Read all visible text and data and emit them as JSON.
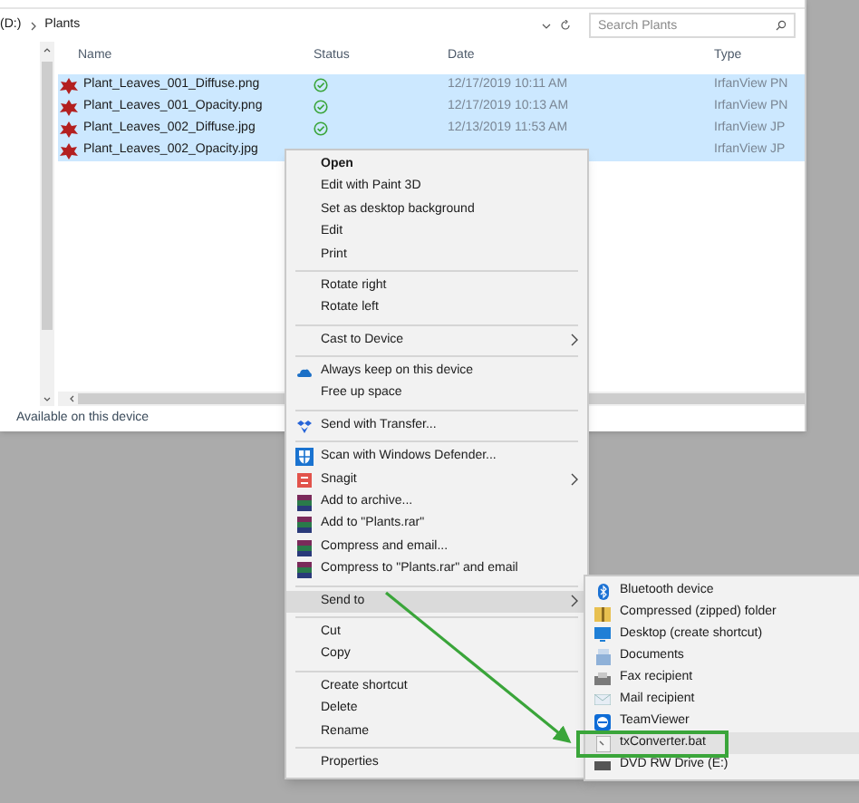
{
  "address_bar": {
    "path": [
      "(D:)",
      "Plants"
    ]
  },
  "search": {
    "placeholder": "Search Plants"
  },
  "file_list": {
    "columns": [
      "Name",
      "Status",
      "Date",
      "Type"
    ],
    "rows": [
      {
        "name": "Plant_Leaves_001_Diffuse.png",
        "available": true,
        "date": "12/17/2019 10:11 AM",
        "type": "IrfanView PN",
        "selected": true
      },
      {
        "name": "Plant_Leaves_001_Opacity.png",
        "available": true,
        "date": "12/17/2019 10:13 AM",
        "type": "IrfanView PN",
        "selected": true
      },
      {
        "name": "Plant_Leaves_002_Diffuse.jpg",
        "available": true,
        "date": "12/13/2019 11:53 AM",
        "type": "IrfanView JP",
        "selected": true
      },
      {
        "name": "Plant_Leaves_002_Opacity.jpg",
        "available": false,
        "type": "IrfanView JP",
        "selected": true
      }
    ]
  },
  "status_bar": "Available on this device",
  "context_menu": {
    "groups": [
      [
        {
          "label": "Open",
          "default": true
        },
        {
          "label": "Edit with Paint 3D"
        },
        {
          "label": "Set as desktop background"
        },
        {
          "label": "Edit"
        },
        {
          "label": "Print"
        }
      ],
      [
        {
          "label": "Rotate right"
        },
        {
          "label": "Rotate left"
        }
      ],
      [
        {
          "label": "Cast to Device",
          "submenu": true
        }
      ],
      [
        {
          "label": "Always keep on this device"
        },
        {
          "label": "Free up space"
        }
      ],
      [
        {
          "label": "Send with Transfer..."
        }
      ],
      [
        {
          "label": "Scan with Windows Defender..."
        },
        {
          "label": "Snagit",
          "submenu": true
        },
        {
          "label": "Add to archive..."
        },
        {
          "label": "Add to \"Plants.rar\""
        },
        {
          "label": "Compress and email..."
        },
        {
          "label": "Compress to \"Plants.rar\" and email"
        }
      ],
      [
        {
          "label": "Send to",
          "submenu": true,
          "highlighted": true
        }
      ],
      [
        {
          "label": "Cut"
        },
        {
          "label": "Copy"
        }
      ],
      [
        {
          "label": "Create shortcut"
        },
        {
          "label": "Delete"
        },
        {
          "label": "Rename"
        }
      ],
      [
        {
          "label": "Properties"
        }
      ]
    ]
  },
  "send_to_menu": {
    "items": [
      {
        "label": "Bluetooth device",
        "highlighted": false
      },
      {
        "label": "Compressed (zipped) folder",
        "highlighted": false
      },
      {
        "label": "Desktop (create shortcut)",
        "highlighted": false
      },
      {
        "label": "Documents",
        "highlighted": false
      },
      {
        "label": "Fax recipient",
        "highlighted": false
      },
      {
        "label": "Mail recipient",
        "highlighted": false
      },
      {
        "label": "TeamViewer",
        "highlighted": false
      },
      {
        "label": "txConverter.bat",
        "highlighted": true
      },
      {
        "label": "DVD RW Drive (E:)",
        "highlighted": false
      }
    ]
  }
}
